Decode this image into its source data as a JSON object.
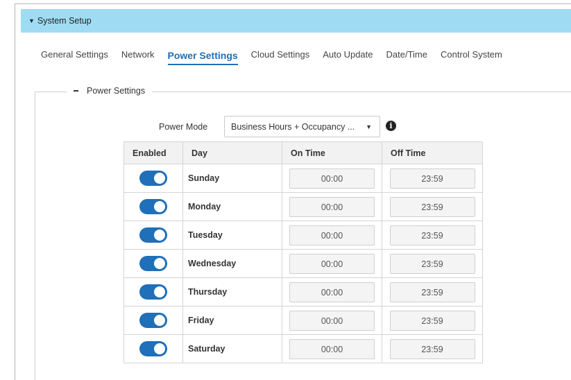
{
  "section": {
    "title": "System Setup"
  },
  "tabs": [
    {
      "label": "General Settings"
    },
    {
      "label": "Network"
    },
    {
      "label": "Power Settings",
      "active": true
    },
    {
      "label": "Cloud Settings"
    },
    {
      "label": "Auto Update"
    },
    {
      "label": "Date/Time"
    },
    {
      "label": "Control System"
    }
  ],
  "power": {
    "legend": "Power Settings",
    "mode_label": "Power Mode",
    "mode_value": "Business Hours + Occupancy ...",
    "columns": {
      "enabled": "Enabled",
      "day": "Day",
      "on": "On Time",
      "off": "Off Time"
    },
    "rows": [
      {
        "day": "Sunday",
        "enabled": true,
        "on": "00:00",
        "off": "23:59"
      },
      {
        "day": "Monday",
        "enabled": true,
        "on": "00:00",
        "off": "23:59"
      },
      {
        "day": "Tuesday",
        "enabled": true,
        "on": "00:00",
        "off": "23:59"
      },
      {
        "day": "Wednesday",
        "enabled": true,
        "on": "00:00",
        "off": "23:59"
      },
      {
        "day": "Thursday",
        "enabled": true,
        "on": "00:00",
        "off": "23:59"
      },
      {
        "day": "Friday",
        "enabled": true,
        "on": "00:00",
        "off": "23:59"
      },
      {
        "day": "Saturday",
        "enabled": true,
        "on": "00:00",
        "off": "23:59"
      }
    ]
  },
  "colors": {
    "header_bg": "#9fdcf3",
    "accent": "#1f6fb9"
  },
  "icons": {
    "collapse": "caret-down-icon",
    "legend": "minus-icon",
    "dropdown": "chevron-down-icon",
    "info": "info-icon"
  }
}
